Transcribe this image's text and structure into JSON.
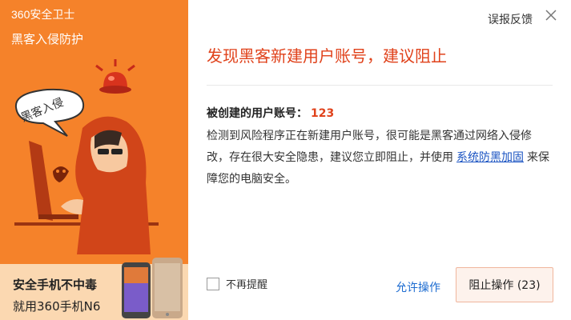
{
  "app": {
    "brand": "360安全卫士",
    "subtitle": "黑客入侵防护"
  },
  "left_panel": {
    "bubble_text": "黑客入侵",
    "promo_line1": "安全手机不中毒",
    "promo_line2": "就用360手机N6"
  },
  "header": {
    "feedback_label": "误报反馈",
    "close_icon": "close-icon"
  },
  "alert": {
    "title": "发现黑客新建用户账号，建议阻止",
    "account_label": "被创建的用户账号：",
    "account_value": "123",
    "desc_part1": "检测到风险程序正在新建用户账号，很可能是黑客通过网络入侵修改，存在很大安全隐患，建议您立即阻止，并使用",
    "desc_link": "系统防黑加固",
    "desc_part2": "来保障您的电脑安全。"
  },
  "footer": {
    "no_remind_label": "不再提醒",
    "allow_label": "允许操作",
    "block_label": "阻止操作 (23)"
  },
  "colors": {
    "left_bg": "#f5822a",
    "title_red": "#e0421b",
    "link_blue": "#1a6ad0",
    "promo_bg": "#fbd8b1"
  }
}
